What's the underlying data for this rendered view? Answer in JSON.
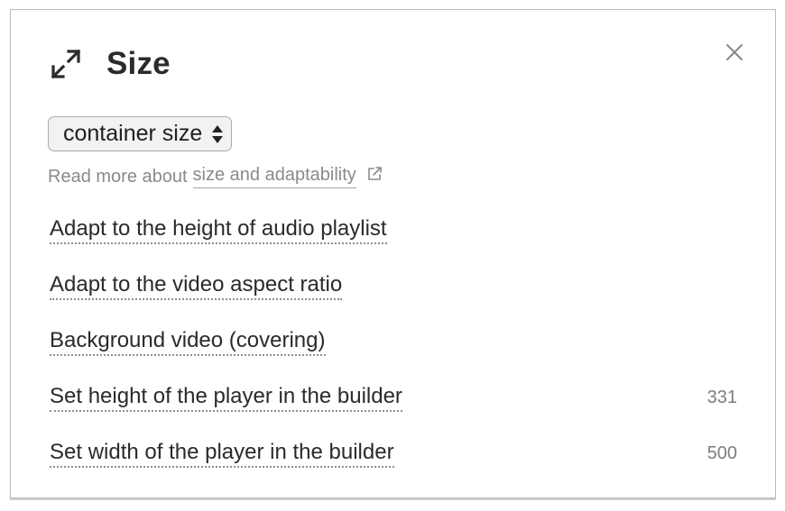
{
  "panel": {
    "title": "Size",
    "icons": {
      "header": "expand-arrows-icon",
      "close": "close-icon",
      "select_arrows": "select-arrows-icon",
      "external_link": "external-link-icon"
    }
  },
  "select": {
    "value": "container size"
  },
  "read_more": {
    "prefix": "Read more about",
    "link_label": "size and adaptability"
  },
  "options": [
    {
      "label": "Adapt to the height of audio playlist",
      "value": ""
    },
    {
      "label": "Adapt to the video aspect ratio",
      "value": ""
    },
    {
      "label": "Background video (covering)",
      "value": ""
    },
    {
      "label": "Set height of the player in the builder",
      "value": "331"
    },
    {
      "label": "Set width of the player in the builder",
      "value": "500"
    }
  ],
  "colors": {
    "title": "#2b2b2b",
    "muted_text": "#8a8a8a",
    "border": "#b9b9b9"
  }
}
